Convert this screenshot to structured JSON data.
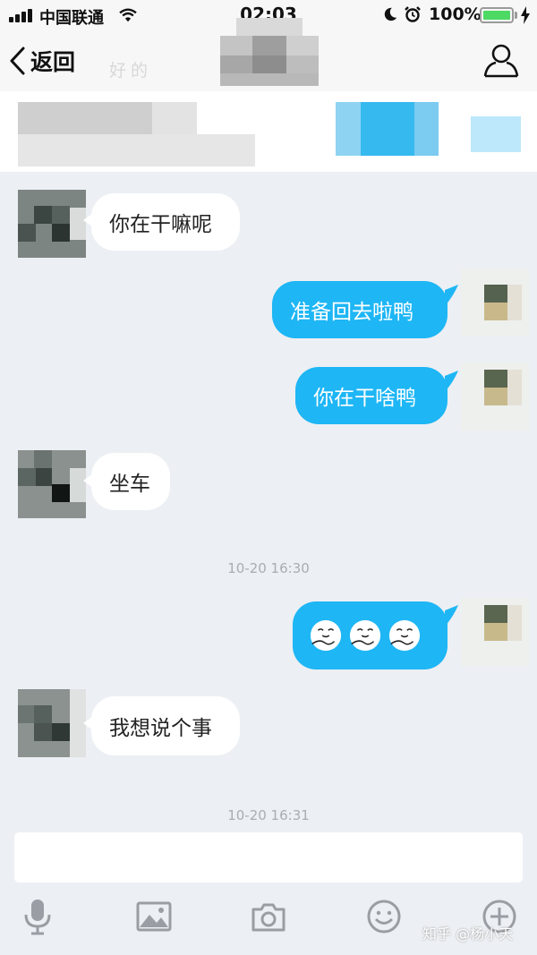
{
  "status_bar": {
    "carrier": "中国联通",
    "time": "02:03",
    "battery_percent": "100%",
    "battery_level": 1.0
  },
  "nav": {
    "back_label": "返回",
    "ghost_text": "好的"
  },
  "messages": [
    {
      "direction": "in",
      "text": "你在干嘛呢"
    },
    {
      "direction": "out",
      "text": "准备回去啦鸭"
    },
    {
      "direction": "out",
      "text": "你在干啥鸭"
    },
    {
      "direction": "in",
      "text": "坐车"
    },
    {
      "direction": "timestamp",
      "text": "10-20 16:30"
    },
    {
      "direction": "out",
      "stickers": [
        "hug-emoji",
        "hug-emoji",
        "hug-emoji"
      ]
    },
    {
      "direction": "in",
      "text": "我想说个事"
    },
    {
      "direction": "timestamp",
      "text": "10-20 16:31"
    }
  ],
  "input": {
    "placeholder": ""
  },
  "toolbar": {
    "icons": [
      "microphone-icon",
      "image-icon",
      "camera-icon",
      "emoji-icon",
      "plus-icon"
    ]
  },
  "watermark": "知乎 @杨小天",
  "colors": {
    "outgoing_bubble": "#1eb6f5",
    "incoming_bubble": "#ffffff",
    "background": "#eceff3",
    "battery": "#4cd964"
  }
}
